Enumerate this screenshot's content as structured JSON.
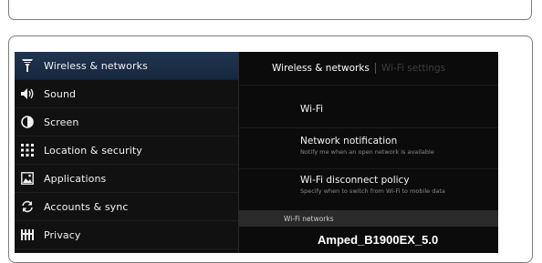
{
  "sidebar": {
    "items": [
      {
        "label": "Wireless & networks",
        "icon": "wifi-antenna-icon",
        "selected": true
      },
      {
        "label": "Sound",
        "icon": "speaker-icon",
        "selected": false
      },
      {
        "label": "Screen",
        "icon": "brightness-icon",
        "selected": false
      },
      {
        "label": "Location & security",
        "icon": "location-grid-icon",
        "selected": false
      },
      {
        "label": "Applications",
        "icon": "applications-icon",
        "selected": false
      },
      {
        "label": "Accounts & sync",
        "icon": "sync-icon",
        "selected": false
      },
      {
        "label": "Privacy",
        "icon": "privacy-icon",
        "selected": false
      }
    ]
  },
  "content": {
    "breadcrumb": {
      "current": "Wireless & networks",
      "sub": "Wi-Fi settings"
    },
    "prefs": [
      {
        "title": "Wi-Fi",
        "summary": ""
      },
      {
        "title": "Network notification",
        "summary": "Notify me when an open network is available"
      },
      {
        "title": "Wi-Fi disconnect policy",
        "summary": "Specify when to switch from Wi-Fi to mobile data"
      }
    ],
    "section_header": "Wi-Fi networks",
    "network_name": "Amped_B1900EX_5.0"
  },
  "colors": {
    "selected_bg": "#1f3550",
    "screen_bg": "#0a0a0a",
    "frame_border": "#7c7c7c"
  }
}
